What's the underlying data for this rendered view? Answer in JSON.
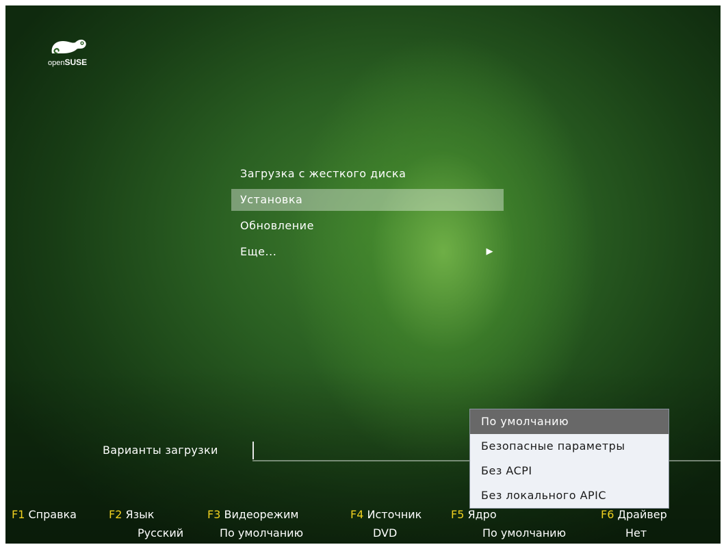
{
  "logo": {
    "brand_prefix": "open",
    "brand_name": "SUSE"
  },
  "menu": {
    "items": [
      {
        "label": "Загрузка с жесткого диска"
      },
      {
        "label": "Установка"
      },
      {
        "label": "Обновление"
      },
      {
        "label": "Еще...",
        "arrow": "▶"
      }
    ],
    "selected_index": 1
  },
  "boot_options": {
    "label": "Варианты загрузки",
    "value": ""
  },
  "dropdown": {
    "items": [
      "По умолчанию",
      "Безопасные параметры",
      "Без ACPI",
      "Без локального APIC"
    ],
    "selected_index": 0
  },
  "function_keys": [
    {
      "key": "F1",
      "label": "Справка",
      "value": ""
    },
    {
      "key": "F2",
      "label": "Язык",
      "value": "Русский"
    },
    {
      "key": "F3",
      "label": "Видеорежим",
      "value": "По умолчанию"
    },
    {
      "key": "F4",
      "label": "Источник",
      "value": "DVD"
    },
    {
      "key": "F5",
      "label": "Ядро",
      "value": "По умолчанию"
    },
    {
      "key": "F6",
      "label": "Драйвер",
      "value": "Нет"
    }
  ],
  "colors": {
    "key_accent": "#f0d020",
    "menu_highlight": "#a8c498",
    "dropdown_bg": "#eef1f6",
    "dropdown_selected": "#686868"
  }
}
